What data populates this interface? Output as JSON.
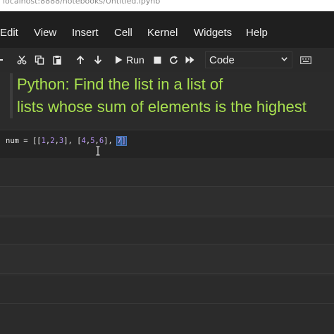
{
  "browser": {
    "url": "localhost:8888/notebooks/Untitled.ipynb"
  },
  "menu": {
    "items": [
      "Edit",
      "View",
      "Insert",
      "Cell",
      "Kernel",
      "Widgets",
      "Help"
    ]
  },
  "toolbar": {
    "run_label": "Run",
    "cell_type": "Code"
  },
  "markdown": {
    "line1": "Python: Find the list in a list of",
    "line2": "lists whose sum of elements is the highest"
  },
  "code": {
    "var": "num",
    "op": " = ",
    "open": "[[",
    "n1": "1",
    "c1": ",",
    "n2": "2",
    "c2": ",",
    "n3": "3",
    "close1": "], [",
    "n4": "4",
    "c3": ",",
    "n5": "5",
    "c4": ",",
    "n6": "6",
    "close2": "], ",
    "n7": "7",
    "close3": "]"
  },
  "colors": {
    "markdown_text": "#a8e04f",
    "number": "#b894f5",
    "selection": "#2d4f7c"
  }
}
